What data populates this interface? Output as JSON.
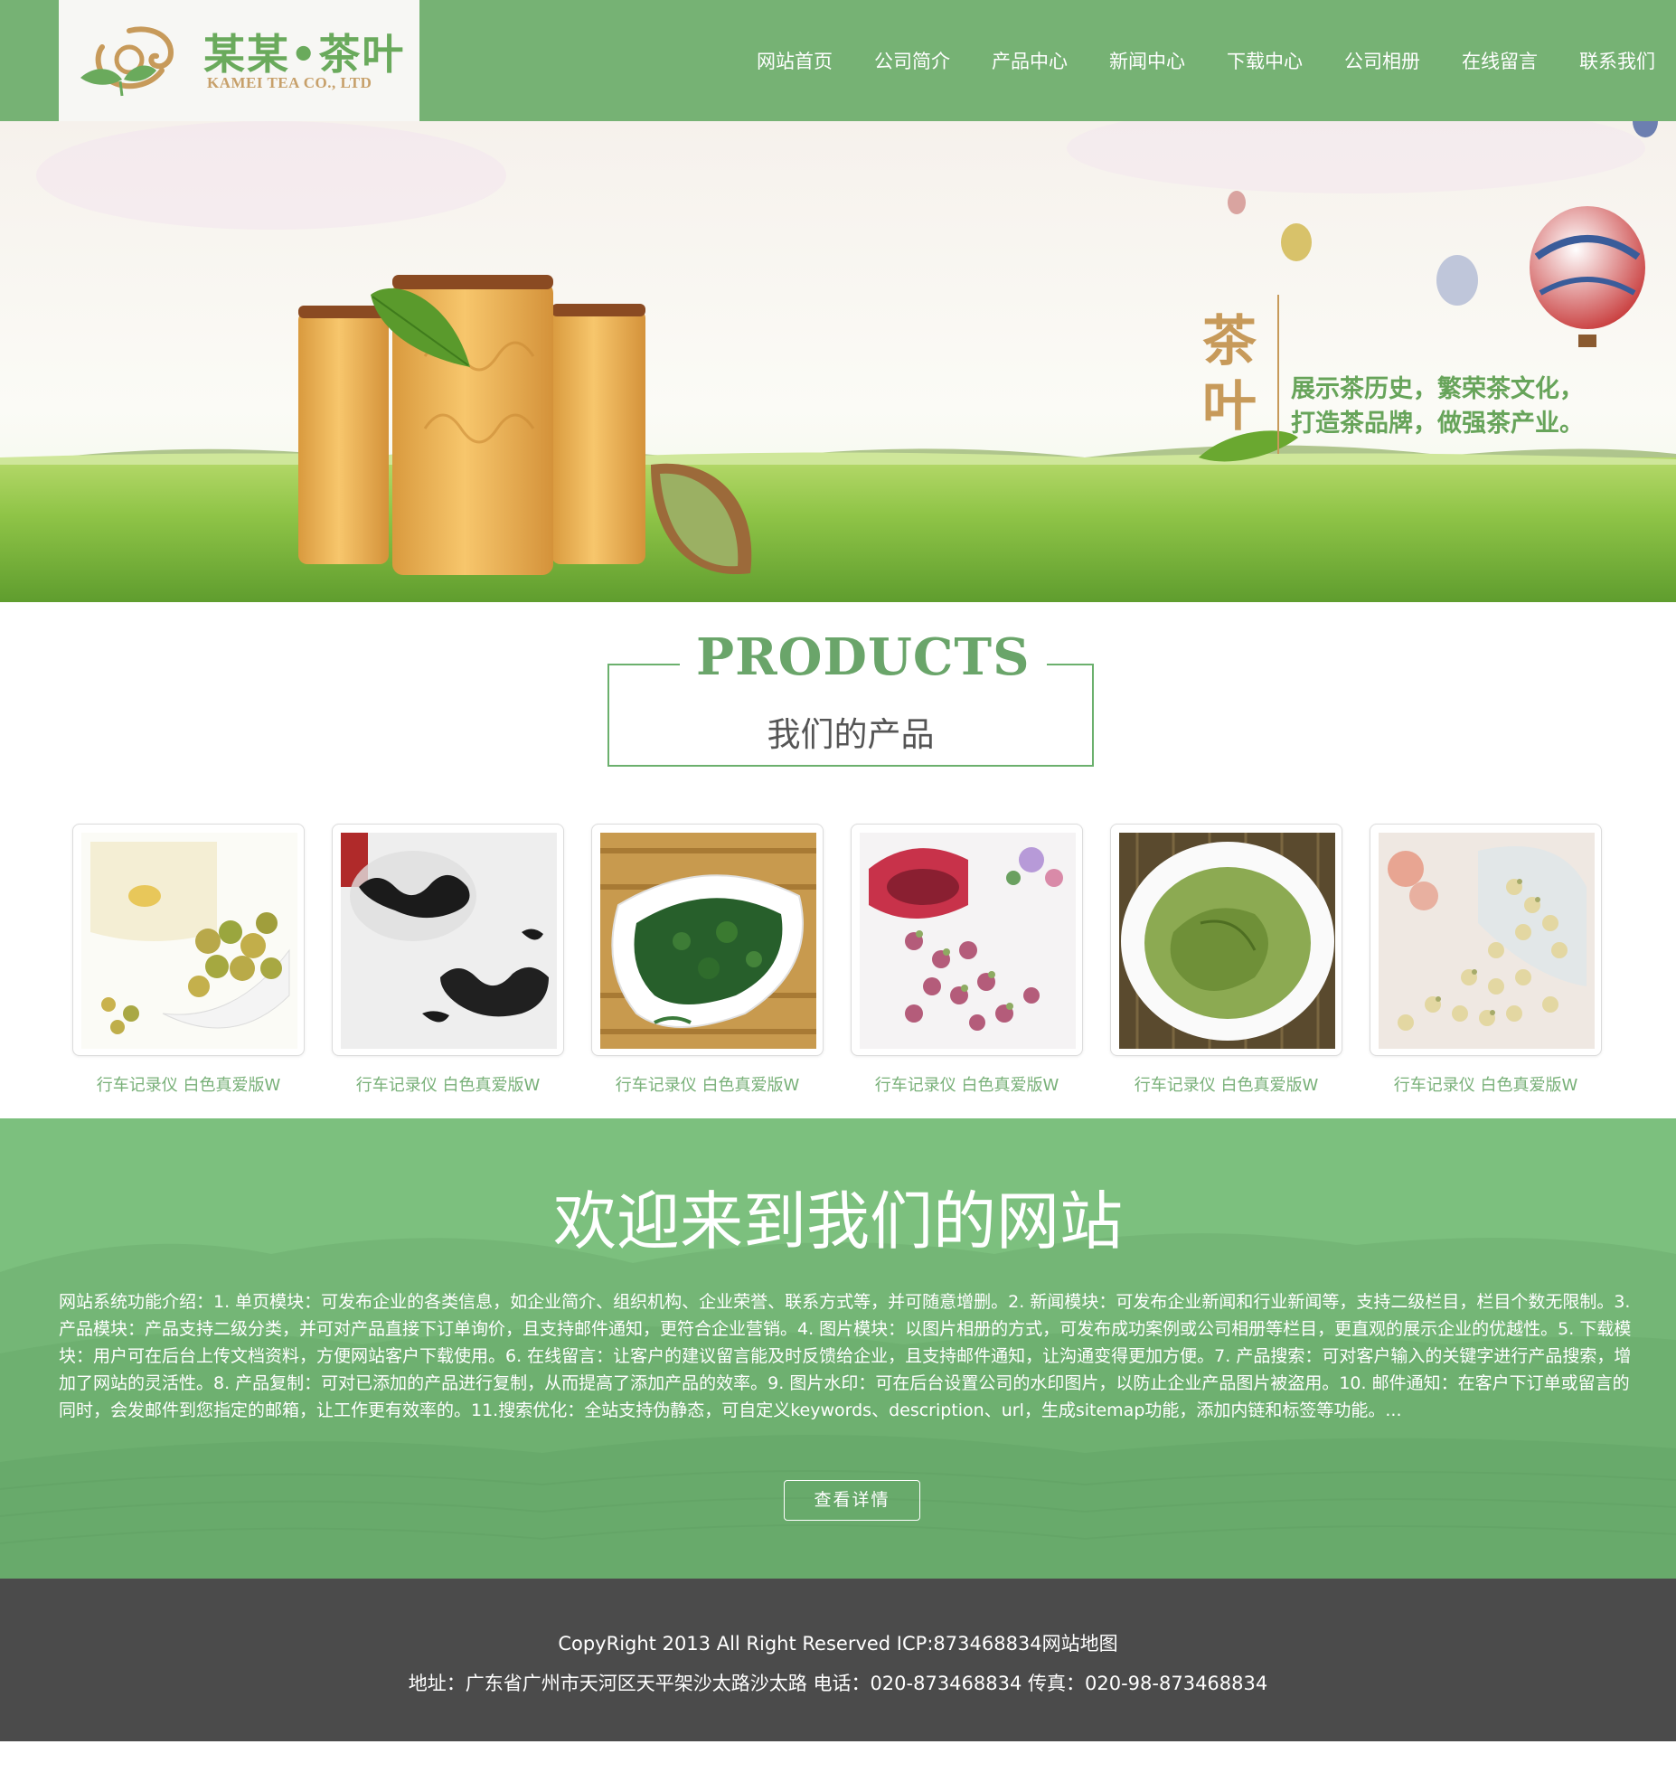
{
  "header": {
    "logo_name": "某某•茶叶",
    "logo_sub": "KAMEI TEA CO., LTD",
    "logo_icon": "tea-leaf-cloud-emblem",
    "nav": [
      "网站首页",
      "公司简介",
      "产品中心",
      "新闻中心",
      "下载中心",
      "公司相册",
      "在线留言",
      "联系我们"
    ]
  },
  "banner": {
    "char_1": "茶",
    "char_2": "叶",
    "slogan_1": "展示茶历史，繁荣茶文化，",
    "slogan_2": "打造茶品牌，做强茶产业。"
  },
  "products": {
    "heading_en": "PRODUCTS",
    "heading_cn": "我们的产品",
    "items": [
      {
        "caption": "行车记录仪 白色真爱版W",
        "image": "chrysanthemum-tea"
      },
      {
        "caption": "行车记录仪 白色真爱版W",
        "image": "black-tea-leaves"
      },
      {
        "caption": "行车记录仪 白色真爱版W",
        "image": "green-tea-spoon"
      },
      {
        "caption": "行车记录仪 白色真爱版W",
        "image": "rose-bud-tea"
      },
      {
        "caption": "行车记录仪 白色真爱版W",
        "image": "brewed-green-tea-bowl"
      },
      {
        "caption": "行车记录仪 白色真爱版W",
        "image": "jasmine-bud-tea"
      }
    ]
  },
  "welcome": {
    "title": "欢迎来到我们的网站",
    "text": "网站系统功能介绍：1. 单页模块：可发布企业的各类信息，如企业简介、组织机构、企业荣誉、联系方式等，并可随意增删。2. 新闻模块：可发布企业新闻和行业新闻等，支持二级栏目，栏目个数无限制。3. 产品模块：产品支持二级分类，并可对产品直接下订单询价，且支持邮件通知，更符合企业营销。4. 图片模块：以图片相册的方式，可发布成功案例或公司相册等栏目，更直观的展示企业的优越性。5. 下载模块：用户可在后台上传文档资料，方便网站客户下载使用。6. 在线留言：让客户的建议留言能及时反馈给企业，且支持邮件通知，让沟通变得更加方便。7. 产品搜索：可对客户输入的关键字进行产品搜索，增加了网站的灵活性。8. 产品复制：可对已添加的产品进行复制，从而提高了添加产品的效率。9. 图片水印：可在后台设置公司的水印图片，以防止企业产品图片被盗用。10. 邮件通知：在客户下订单或留言的同时，会发邮件到您指定的邮箱，让工作更有效率的。11.搜索优化：全站支持伪静态，可自定义keywords、description、url，生成sitemap功能，添加内链和标签等功能。...",
    "button": "查看详情"
  },
  "footer": {
    "copyright": "CopyRight 2013 All Right Reserved ICP:873468834网站地图",
    "contact": "地址：广东省广州市天河区天平架沙太路沙太路 电话：020-873468834 传真：020-98-873468834"
  },
  "colors": {
    "brand_green": "#76b274",
    "welcome_green": "#7cc07e",
    "footer_gray": "#4b4b4b",
    "gold": "#c79a5a"
  }
}
